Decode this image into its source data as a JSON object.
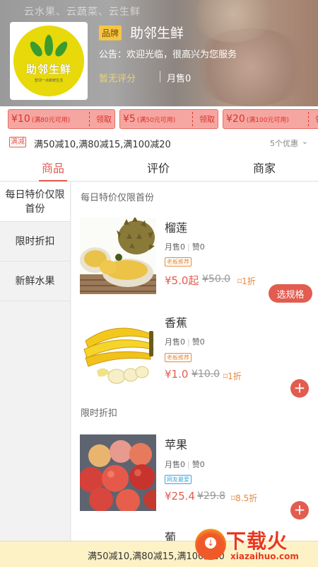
{
  "header": {
    "blur_text": "云水果、云蔬菜、云生鲜",
    "logo_title": "助邻生鲜",
    "logo_sub": "帮邻一点新鲜生活",
    "brand_badge": "品牌",
    "store_name": "助邻生鲜",
    "notice": "公告：欢迎光临，很高兴为您服务",
    "rating": "暂无评分",
    "monthly_sales": "月售0"
  },
  "coupons": [
    {
      "amount": "¥10",
      "condition": "(满80元可用)",
      "action": "领取"
    },
    {
      "amount": "¥5",
      "condition": "(满50元可用)",
      "action": "领取"
    },
    {
      "amount": "¥20",
      "condition": "(满100元可用)",
      "action": "领取"
    }
  ],
  "promo": {
    "tag": "满减",
    "text": "满50减10,满80减15,满100减20",
    "count": "5个优惠",
    "chevron": "⌄"
  },
  "tabs": [
    {
      "label": "商品",
      "active": true
    },
    {
      "label": "评价",
      "active": false
    },
    {
      "label": "商家",
      "active": false
    }
  ],
  "sidebar": [
    {
      "label": "每日特价仅限首份",
      "active": true
    },
    {
      "label": "限时折扣",
      "active": false
    },
    {
      "label": "新鲜水果",
      "active": false
    }
  ],
  "sections": [
    {
      "title": "每日特价仅限首份",
      "products": [
        {
          "name": "榴莲",
          "sales": "月售0",
          "likes": "赞0",
          "tag": "老板推荐",
          "price": "¥5.0起",
          "old_price": "¥50.0",
          "discount": "1折",
          "action": "选规格"
        },
        {
          "name": "香蕉",
          "sales": "月售0",
          "likes": "赞0",
          "tag": "老板推荐",
          "price": "¥1.0",
          "old_price": "¥10.0",
          "discount": "1折",
          "action": "+"
        }
      ]
    },
    {
      "title": "限时折扣",
      "products": [
        {
          "name": "苹果",
          "sales": "月售0",
          "likes": "赞0",
          "tag": "网友最爱",
          "price": "¥25.4",
          "old_price": "¥29.8",
          "discount": "8.5折",
          "action": "+"
        },
        {
          "name": "葡"
        }
      ]
    }
  ],
  "bottom_bar": {
    "text": "满50减10,满80减15,满100减20"
  },
  "watermark": {
    "text": "下载火",
    "sub": "xiazaihuo.com"
  },
  "colors": {
    "accent": "#e25c4f",
    "badge": "#f6c643",
    "bottom_bar": "#fdf2c6"
  }
}
